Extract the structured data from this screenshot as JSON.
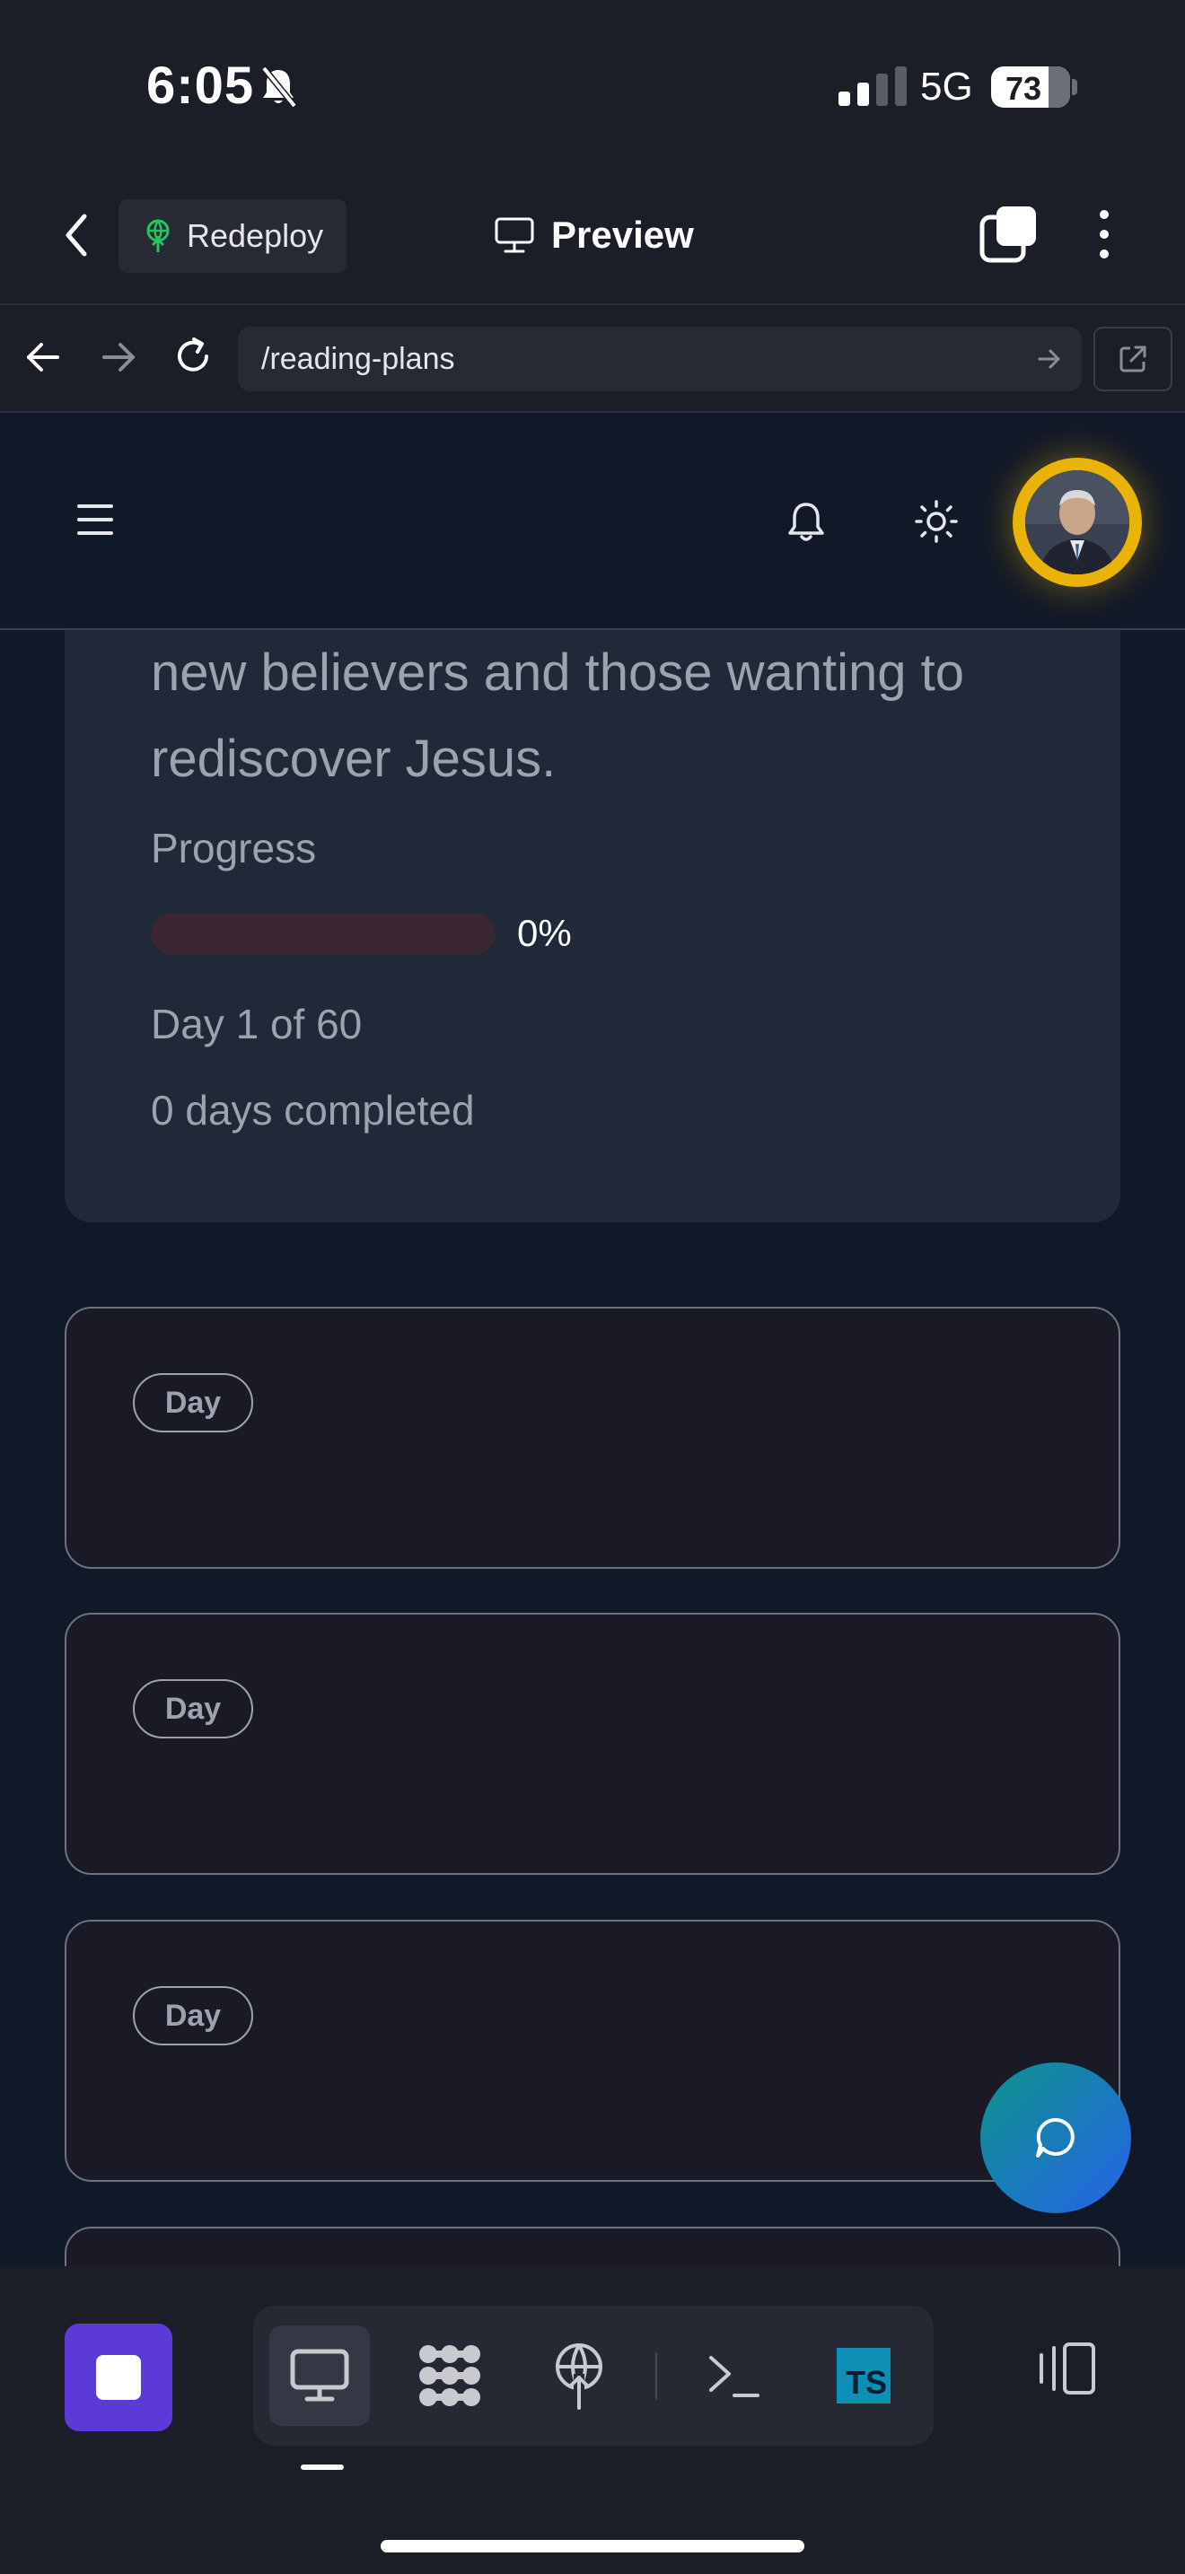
{
  "status_bar": {
    "time": "6:05",
    "network": "5G",
    "battery": "73"
  },
  "app_header": {
    "redeploy_label": "Redeploy",
    "preview_label": "Preview"
  },
  "browser": {
    "url": "/reading-plans"
  },
  "plan": {
    "description": "new believers and those wanting to rediscover Jesus.",
    "progress_label": "Progress",
    "progress_value": 0,
    "progress_text": "0%",
    "day_count": "Day 1 of 60",
    "days_completed": "0 days completed"
  },
  "day_cards": [
    {
      "badge": "Day"
    },
    {
      "badge": "Day"
    },
    {
      "badge": "Day"
    }
  ],
  "toolbar": {
    "ts_label": "TS"
  },
  "colors": {
    "accent": "#eab308",
    "stop_button": "#5b3ad8",
    "progress_fill": "#dc2626",
    "page_background": "#111827",
    "card_background": "#1f2937"
  },
  "icons": [
    "bell-off-icon",
    "back-icon",
    "redeploy-icon",
    "monitor-icon",
    "tabs-icon",
    "more-icon",
    "arrow-left-icon",
    "arrow-right-icon",
    "reload-icon",
    "external-link-icon",
    "menu-icon",
    "bell-icon",
    "sun-icon",
    "chat-icon",
    "stop-icon",
    "grid-icon",
    "globe-upload-icon",
    "terminal-icon",
    "typescript-icon",
    "split-view-icon"
  ]
}
